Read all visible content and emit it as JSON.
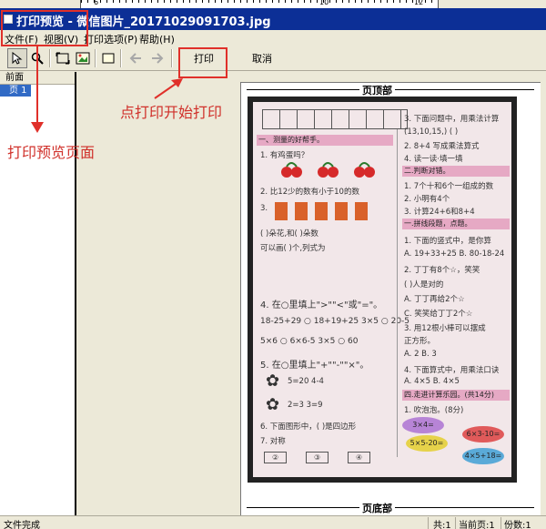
{
  "ruler": {
    "numbers": [
      "6",
      "10",
      "12"
    ]
  },
  "window": {
    "title": "打印预览 - 微信图片_20171029091703.jpg"
  },
  "menu": {
    "items": [
      "文件(F)",
      "视图(V)",
      "打印选项(P)",
      "帮助(H)"
    ]
  },
  "toolbar": {
    "print_label": "打印",
    "cancel_label": "取消"
  },
  "page_list": {
    "header": "前面",
    "items": [
      "页 1"
    ]
  },
  "preview": {
    "header_label": "页顶部",
    "footer_label": "页底部"
  },
  "photo_content": {
    "left_lines": [
      "一、测量的好帮手。",
      "1. 有鸡蛋吗？",
      "2. 比12少的数有小于10的数",
      "3.",
      "(  )朵花,和(  )朵数",
      "可以画(  )个,列式为",
      "4. 在○里填上\">\"\"<\"或\"=\"。",
      "18-25+29 ○ 18+19+25    3×5 ○ 20-5",
      "5×6 ○ 6×6-5          3×5 ○ 60",
      "5. 在○里填上\"+\"\"-\"\"×\"。",
      "5=20      4-4",
      "2=3       3=9",
      "6. 下面图形中，(  )是四边形",
      "7. 对称"
    ],
    "right_lines": [
      "3. 下面问题中，用乘法计算",
      "(13,10,15,)    (   )",
      "2. 8+4 写成乘法算式",
      "4. 读一读·填一填",
      "二.判断对错。",
      "1. 7个十和6个一组成的数",
      "2. 小明有4个",
      "3. 计算24+6和8+4",
      "一.拼线段题，点题。",
      "1. 下面的竖式中，是你算",
      "A. 19+33+25  B. 80-18-24",
      "2. 丁丁有8个☆，笑笑",
      "(  )人是对的",
      "A. 丁丁再给2个☆",
      "C. 笑笑给丁丁2个☆",
      "3. 用12根小棒可以摆成",
      "正方形。",
      "A. 2          B. 3",
      "4. 下面算式中，用乘法口诀",
      "A. 4×5      B. 4×5",
      "四.走进计算乐园。(共14分)",
      "1. 吹泡泡。(8分)"
    ],
    "ellipses": [
      "3×4=",
      "5×5-20=",
      "6×3-10=",
      "4×5+18="
    ],
    "hexes": [
      "②",
      "③",
      "④"
    ]
  },
  "annotations": {
    "preview_label": "打印预览页面",
    "print_hint": "点打印开始打印"
  },
  "status": {
    "left": "文件完成",
    "total": "共:1",
    "current": "当前页:1",
    "copies": "份数:1"
  }
}
